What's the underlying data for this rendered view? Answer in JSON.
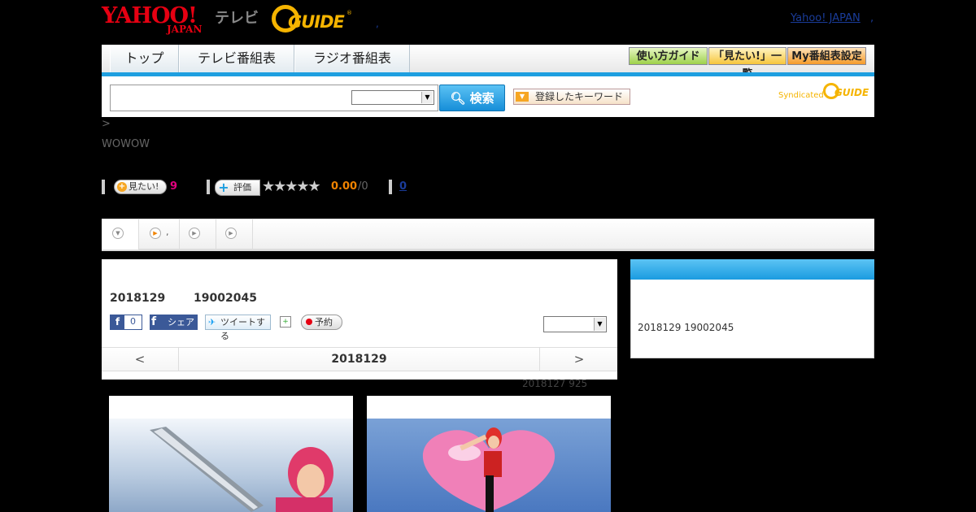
{
  "header": {
    "yahoo_logo": "YAHOO!",
    "yahoo_japan": "JAPAN",
    "tv_label": "テレビ",
    "gguide_logo": "GUIDE",
    "gguide_reg": "®",
    "dot": ",",
    "yahoo_japan_link": "Yahoo! JAPAN",
    "yahoo_japan_link_suffix": ","
  },
  "nav": {
    "tabs": [
      "トップ",
      "テレビ番組表",
      "ラジオ番組表"
    ],
    "buttons": [
      "使い方ガイド",
      "「見たい!」一覧",
      "My番組表設定"
    ]
  },
  "search": {
    "input_value": "",
    "button_label": "検索",
    "keyword_button": "登録したキーワード",
    "syndicated": "Syndicated",
    "syndicated_logo": "GUIDE"
  },
  "breadcrumb": ">",
  "channel": "WOWOW",
  "rating": {
    "want_label": "見たい!",
    "want_count": "9",
    "rate_label": "評価",
    "stars": "★★★★★",
    "score": "0.00",
    "score_count": "/0",
    "review_count": "0"
  },
  "subtabs": [
    ",",
    ""
  ],
  "program": {
    "date": "2018129",
    "time": "19002045",
    "fb_like_count": "0",
    "fb_share": "シェア",
    "tweet": "ツイートする",
    "reserve": "予約",
    "prev": "<",
    "current_day": "2018129",
    "next": ">",
    "updated": "2018127  925"
  },
  "side": {
    "text": "2018129  19002045"
  },
  "colors": {
    "accent": "#1e9fe0",
    "brand_red": "#e60012",
    "gguide_yellow": "#f5b400"
  }
}
